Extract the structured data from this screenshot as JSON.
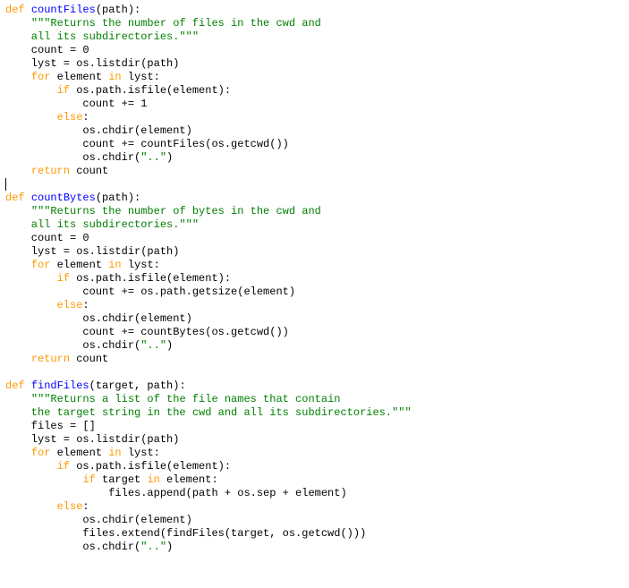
{
  "colors": {
    "kw": "#ff9900",
    "def": "#0000ff",
    "str": "#008000",
    "txt": "#000000"
  },
  "lines": [
    {
      "name": "line-01",
      "parts": [
        {
          "c": "kw",
          "t": "def"
        },
        {
          "c": "txt",
          "t": " "
        },
        {
          "c": "def",
          "t": "countFiles"
        },
        {
          "c": "txt",
          "t": "(path):"
        }
      ]
    },
    {
      "name": "line-02",
      "parts": [
        {
          "c": "txt",
          "t": "    "
        },
        {
          "c": "str",
          "t": "\"\"\"Returns the number of files in the cwd and"
        }
      ]
    },
    {
      "name": "line-03",
      "parts": [
        {
          "c": "str",
          "t": "    all its subdirectories.\"\"\""
        }
      ]
    },
    {
      "name": "line-04",
      "parts": [
        {
          "c": "txt",
          "t": "    count = 0"
        }
      ]
    },
    {
      "name": "line-05",
      "parts": [
        {
          "c": "txt",
          "t": "    lyst = os.listdir(path)"
        }
      ]
    },
    {
      "name": "line-06",
      "parts": [
        {
          "c": "txt",
          "t": "    "
        },
        {
          "c": "kw",
          "t": "for"
        },
        {
          "c": "txt",
          "t": " element "
        },
        {
          "c": "kw",
          "t": "in"
        },
        {
          "c": "txt",
          "t": " lyst:"
        }
      ]
    },
    {
      "name": "line-07",
      "parts": [
        {
          "c": "txt",
          "t": "        "
        },
        {
          "c": "kw",
          "t": "if"
        },
        {
          "c": "txt",
          "t": " os.path.isfile(element):"
        }
      ]
    },
    {
      "name": "line-08",
      "parts": [
        {
          "c": "txt",
          "t": "            count += 1"
        }
      ]
    },
    {
      "name": "line-09",
      "parts": [
        {
          "c": "txt",
          "t": "        "
        },
        {
          "c": "kw",
          "t": "else"
        },
        {
          "c": "txt",
          "t": ":"
        }
      ]
    },
    {
      "name": "line-10",
      "parts": [
        {
          "c": "txt",
          "t": "            os.chdir(element)"
        }
      ]
    },
    {
      "name": "line-11",
      "parts": [
        {
          "c": "txt",
          "t": "            count += countFiles(os.getcwd())"
        }
      ]
    },
    {
      "name": "line-12",
      "parts": [
        {
          "c": "txt",
          "t": "            os.chdir("
        },
        {
          "c": "str",
          "t": "\"..\""
        },
        {
          "c": "txt",
          "t": ")"
        }
      ]
    },
    {
      "name": "line-13",
      "parts": [
        {
          "c": "txt",
          "t": "    "
        },
        {
          "c": "kw",
          "t": "return"
        },
        {
          "c": "txt",
          "t": " count"
        }
      ]
    },
    {
      "name": "line-14",
      "caret": true,
      "parts": []
    },
    {
      "name": "line-15",
      "parts": [
        {
          "c": "kw",
          "t": "def"
        },
        {
          "c": "txt",
          "t": " "
        },
        {
          "c": "def",
          "t": "countBytes"
        },
        {
          "c": "txt",
          "t": "(path):"
        }
      ]
    },
    {
      "name": "line-16",
      "parts": [
        {
          "c": "txt",
          "t": "    "
        },
        {
          "c": "str",
          "t": "\"\"\"Returns the number of bytes in the cwd and"
        }
      ]
    },
    {
      "name": "line-17",
      "parts": [
        {
          "c": "str",
          "t": "    all its subdirectories.\"\"\""
        }
      ]
    },
    {
      "name": "line-18",
      "parts": [
        {
          "c": "txt",
          "t": "    count = 0"
        }
      ]
    },
    {
      "name": "line-19",
      "parts": [
        {
          "c": "txt",
          "t": "    lyst = os.listdir(path)"
        }
      ]
    },
    {
      "name": "line-20",
      "parts": [
        {
          "c": "txt",
          "t": "    "
        },
        {
          "c": "kw",
          "t": "for"
        },
        {
          "c": "txt",
          "t": " element "
        },
        {
          "c": "kw",
          "t": "in"
        },
        {
          "c": "txt",
          "t": " lyst:"
        }
      ]
    },
    {
      "name": "line-21",
      "parts": [
        {
          "c": "txt",
          "t": "        "
        },
        {
          "c": "kw",
          "t": "if"
        },
        {
          "c": "txt",
          "t": " os.path.isfile(element):"
        }
      ]
    },
    {
      "name": "line-22",
      "parts": [
        {
          "c": "txt",
          "t": "            count += os.path.getsize(element)"
        }
      ]
    },
    {
      "name": "line-23",
      "parts": [
        {
          "c": "txt",
          "t": "        "
        },
        {
          "c": "kw",
          "t": "else"
        },
        {
          "c": "txt",
          "t": ":"
        }
      ]
    },
    {
      "name": "line-24",
      "parts": [
        {
          "c": "txt",
          "t": "            os.chdir(element)"
        }
      ]
    },
    {
      "name": "line-25",
      "parts": [
        {
          "c": "txt",
          "t": "            count += countBytes(os.getcwd())"
        }
      ]
    },
    {
      "name": "line-26",
      "parts": [
        {
          "c": "txt",
          "t": "            os.chdir("
        },
        {
          "c": "str",
          "t": "\"..\""
        },
        {
          "c": "txt",
          "t": ")"
        }
      ]
    },
    {
      "name": "line-27",
      "parts": [
        {
          "c": "txt",
          "t": "    "
        },
        {
          "c": "kw",
          "t": "return"
        },
        {
          "c": "txt",
          "t": " count"
        }
      ]
    },
    {
      "name": "line-28",
      "parts": []
    },
    {
      "name": "line-29",
      "parts": [
        {
          "c": "kw",
          "t": "def"
        },
        {
          "c": "txt",
          "t": " "
        },
        {
          "c": "def",
          "t": "findFiles"
        },
        {
          "c": "txt",
          "t": "(target, path):"
        }
      ]
    },
    {
      "name": "line-30",
      "parts": [
        {
          "c": "txt",
          "t": "    "
        },
        {
          "c": "str",
          "t": "\"\"\"Returns a list of the file names that contain"
        }
      ]
    },
    {
      "name": "line-31",
      "parts": [
        {
          "c": "str",
          "t": "    the target string in the cwd and all its subdirectories.\"\"\""
        }
      ]
    },
    {
      "name": "line-32",
      "parts": [
        {
          "c": "txt",
          "t": "    files = []"
        }
      ]
    },
    {
      "name": "line-33",
      "parts": [
        {
          "c": "txt",
          "t": "    lyst = os.listdir(path)"
        }
      ]
    },
    {
      "name": "line-34",
      "parts": [
        {
          "c": "txt",
          "t": "    "
        },
        {
          "c": "kw",
          "t": "for"
        },
        {
          "c": "txt",
          "t": " element "
        },
        {
          "c": "kw",
          "t": "in"
        },
        {
          "c": "txt",
          "t": " lyst:"
        }
      ]
    },
    {
      "name": "line-35",
      "parts": [
        {
          "c": "txt",
          "t": "        "
        },
        {
          "c": "kw",
          "t": "if"
        },
        {
          "c": "txt",
          "t": " os.path.isfile(element):"
        }
      ]
    },
    {
      "name": "line-36",
      "parts": [
        {
          "c": "txt",
          "t": "            "
        },
        {
          "c": "kw",
          "t": "if"
        },
        {
          "c": "txt",
          "t": " target "
        },
        {
          "c": "kw",
          "t": "in"
        },
        {
          "c": "txt",
          "t": " element:"
        }
      ]
    },
    {
      "name": "line-37",
      "parts": [
        {
          "c": "txt",
          "t": "                files.append(path + os.sep + element)"
        }
      ]
    },
    {
      "name": "line-38",
      "parts": [
        {
          "c": "txt",
          "t": "        "
        },
        {
          "c": "kw",
          "t": "else"
        },
        {
          "c": "txt",
          "t": ":"
        }
      ]
    },
    {
      "name": "line-39",
      "parts": [
        {
          "c": "txt",
          "t": "            os.chdir(element)"
        }
      ]
    },
    {
      "name": "line-40",
      "parts": [
        {
          "c": "txt",
          "t": "            files.extend(findFiles(target, os.getcwd()))"
        }
      ]
    },
    {
      "name": "line-41",
      "parts": [
        {
          "c": "txt",
          "t": "            os.chdir("
        },
        {
          "c": "str",
          "t": "\"..\""
        },
        {
          "c": "txt",
          "t": ")"
        }
      ]
    }
  ]
}
